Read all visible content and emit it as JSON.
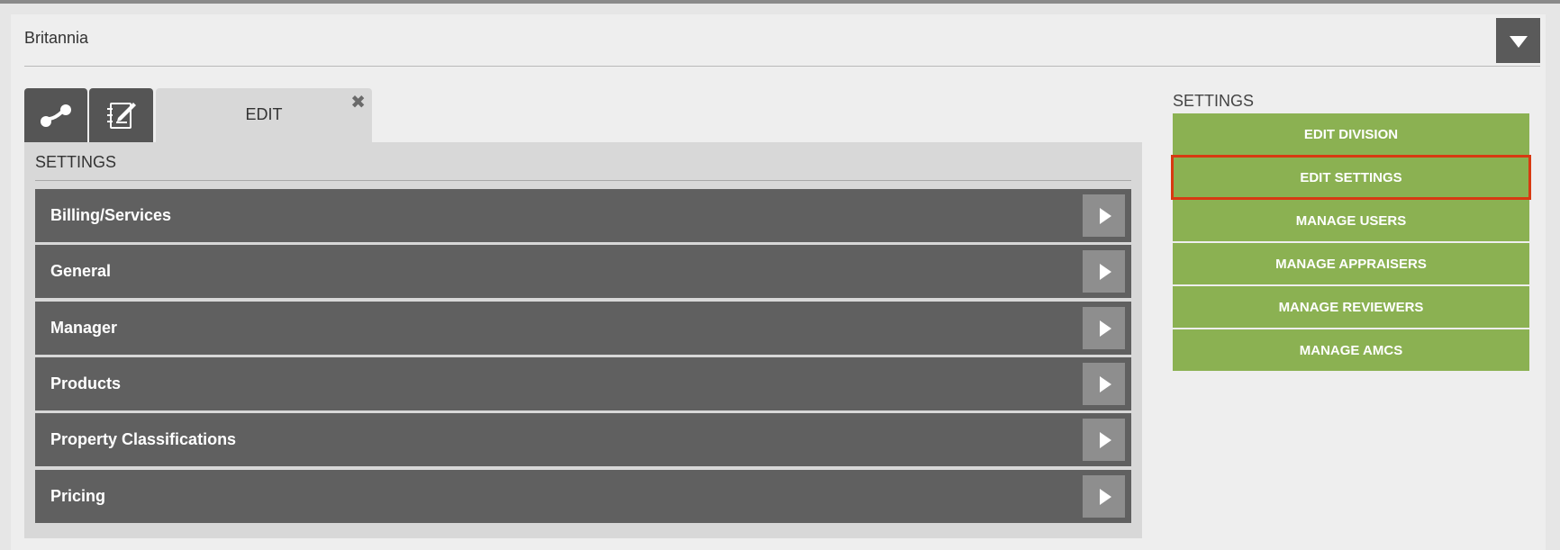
{
  "header": {
    "title": "Britannia",
    "toggle_icon": "chevron-down-icon"
  },
  "tabs": {
    "icon_tab_1": "link-icon",
    "icon_tab_2": "notebook-edit-icon",
    "active_label": "EDIT",
    "close_glyph": "✖"
  },
  "settings": {
    "title": "SETTINGS",
    "items": [
      {
        "label": "Billing/Services"
      },
      {
        "label": "General"
      },
      {
        "label": "Manager"
      },
      {
        "label": "Products"
      },
      {
        "label": "Property Classifications"
      },
      {
        "label": "Pricing"
      }
    ]
  },
  "sidebar": {
    "title": "SETTINGS",
    "buttons": [
      {
        "label": "EDIT DIVISION"
      },
      {
        "label": "EDIT SETTINGS",
        "selected": true
      },
      {
        "label": "MANAGE USERS"
      },
      {
        "label": "MANAGE APPRAISERS"
      },
      {
        "label": "MANAGE REVIEWERS"
      },
      {
        "label": "MANAGE AMCS"
      }
    ]
  },
  "colors": {
    "accent_green": "#8bb152",
    "selected_outline": "#d83a12",
    "item_dark": "#606060"
  }
}
